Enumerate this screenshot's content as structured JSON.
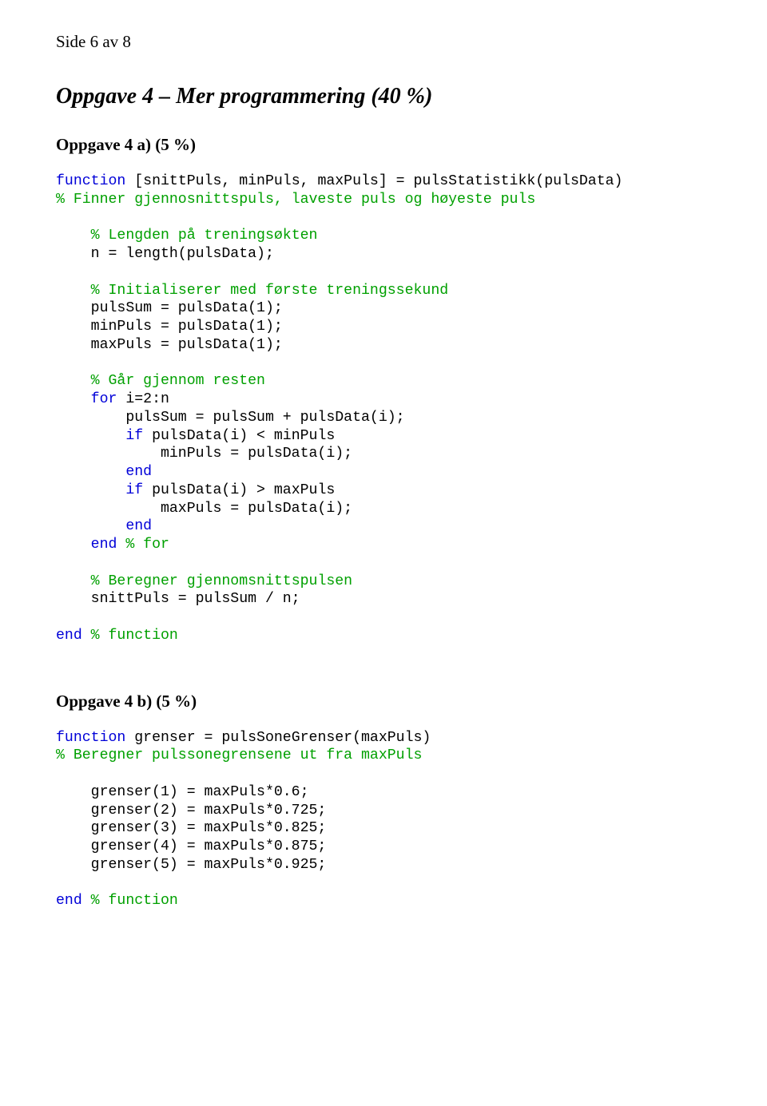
{
  "page_indicator": "Side 6 av 8",
  "heading_main": "Oppgave 4 – Mer programmering (40 %)",
  "section_a": {
    "heading": "Oppgave 4 a) (5 %)",
    "code": {
      "l1_kw": "function",
      "l1_rest": " [snittPuls, minPuls, maxPuls] = pulsStatistikk(pulsData)",
      "l2_cm": "% Finner gjennosnittspuls, laveste puls og høyeste puls",
      "l3_cm": "% Lengden på treningsøkten",
      "l4": "    n = length(pulsData);",
      "l5_cm": "% Initialiserer med første treningssekund",
      "l6": "    pulsSum = pulsData(1);",
      "l7": "    minPuls = pulsData(1);",
      "l8": "    maxPuls = pulsData(1);",
      "l9_cm": "% Går gjennom resten",
      "l10_kw": "for",
      "l10_rest": " i=2:n",
      "l11": "        pulsSum = pulsSum + pulsData(i);",
      "l12_kw": "if",
      "l12_rest": " pulsData(i) < minPuls",
      "l13": "            minPuls = pulsData(i);",
      "l14_kw": "end",
      "l15_kw": "if",
      "l15_rest": " pulsData(i) > maxPuls",
      "l16": "            maxPuls = pulsData(i);",
      "l17_kw": "end",
      "l18_kw": "end",
      "l18_cm": " % for",
      "l19_cm": "% Beregner gjennomsnittspulsen",
      "l20": "    snittPuls = pulsSum / n;",
      "l21_kw": "end",
      "l21_cm": " % function"
    }
  },
  "section_b": {
    "heading": "Oppgave 4 b) (5 %)",
    "code": {
      "l1_kw": "function",
      "l1_rest": " grenser = pulsSoneGrenser(maxPuls)",
      "l2_cm": "% Beregner pulssonegrensene ut fra maxPuls",
      "l3": "    grenser(1) = maxPuls*0.6;",
      "l4": "    grenser(2) = maxPuls*0.725;",
      "l5": "    grenser(3) = maxPuls*0.825;",
      "l6": "    grenser(4) = maxPuls*0.875;",
      "l7": "    grenser(5) = maxPuls*0.925;",
      "l8_kw": "end",
      "l8_cm": " % function"
    }
  }
}
